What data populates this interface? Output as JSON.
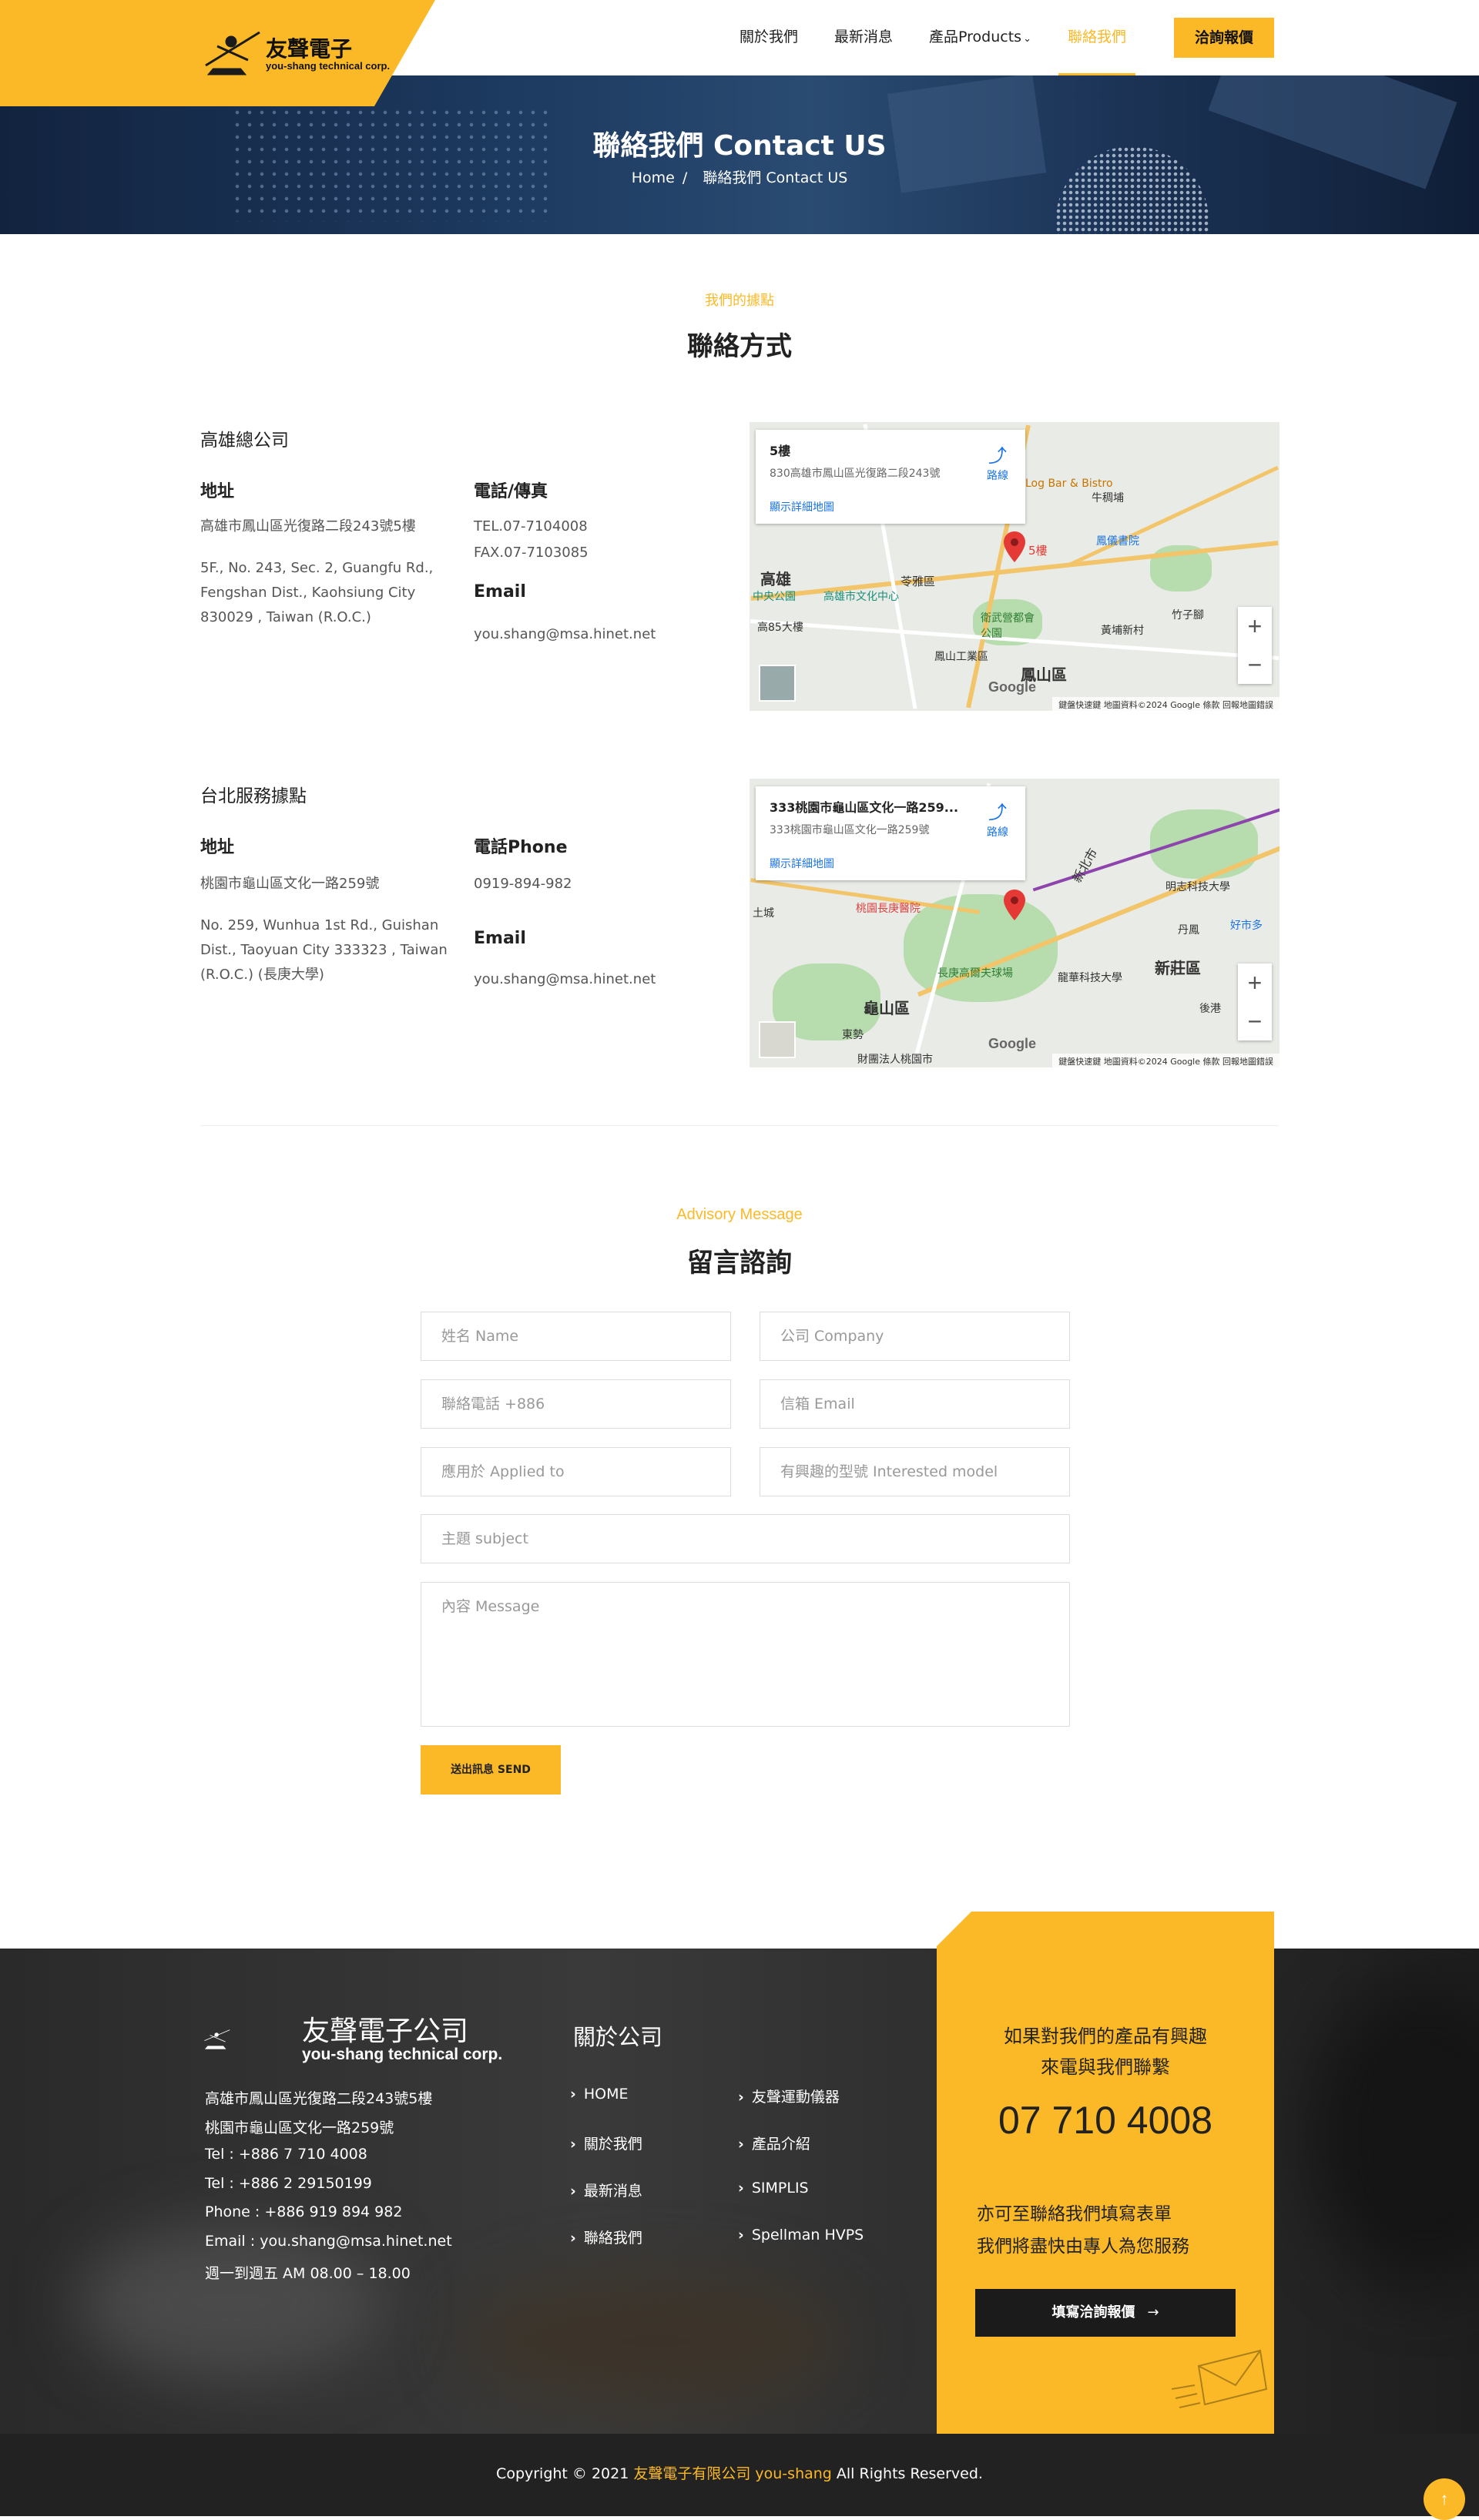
{
  "header": {
    "logo_cn": "友聲電子",
    "logo_en": "you-shang technical corp.",
    "nav": [
      "關於我們",
      "最新消息",
      "產品Products",
      "聯絡我們"
    ],
    "nav_dropdown_icon": "chevron-down-icon",
    "quote_label": "洽詢報價"
  },
  "banner": {
    "title": "聯絡我們 Contact US",
    "crumb_home": "Home",
    "crumb_sep": "/",
    "crumb_current": "聯絡我們 Contact US"
  },
  "contact": {
    "subtitle": "我們的據點",
    "title": "聯絡方式",
    "offices": [
      {
        "name": "高雄總公司",
        "addr_head": "地址",
        "addr_cn": "高雄市鳳山區光復路二段243號5樓",
        "addr_en": "5F., No. 243, Sec. 2, Guangfu Rd., Fengshan Dist., Kaohsiung City 830029 , Taiwan (R.O.C.)",
        "tel_head": "電話/傳真",
        "tel": "TEL.07-7104008",
        "fax": "FAX.07-7103085",
        "email_head": "Email",
        "email": "you.shang@msa.hinet.net",
        "map": {
          "card_title": "5樓",
          "card_addr": "830高雄市鳳山區光復路二段243號",
          "card_link": "顯示詳細地圖",
          "directions": "路線",
          "labels": [
            "高雄",
            "鳳山區",
            "高雄市文化中心",
            "衛武營都會公園",
            "鳳儀書院",
            "牛稠埔",
            "竹子腳",
            "黃埔新村",
            "鳳山工業區",
            "Log Bar & Bistro",
            "苓雅區",
            "高85大樓",
            "中央公園",
            "5樓"
          ],
          "attribution": "鍵盤快速鍵  地圖資料©2024 Google  條款  回報地圖錯誤"
        }
      },
      {
        "name": "台北服務據點",
        "addr_head": "地址",
        "addr_cn": "桃園市龜山區文化一路259號",
        "addr_en": "No. 259, Wunhua 1st Rd., Guishan Dist., Taoyuan City 333323 , Taiwan (R.O.C.) (長庚大學)",
        "tel_head": "電話Phone",
        "tel": "0919-894-982",
        "email_head": "Email",
        "email": "you.shang@msa.hinet.net",
        "map": {
          "card_title": "333桃園市龜山區文化一路259...",
          "card_addr": "333桃園市龜山區文化一路259號",
          "card_link": "顯示詳細地圖",
          "directions": "路線",
          "labels": [
            "龜山區",
            "新莊區",
            "桃園長庚醫院",
            "長庚高爾夫球場",
            "龍華科技大學",
            "明志科技大學",
            "新北市",
            "東勢",
            "丹鳳",
            "後港",
            "土城",
            "財團法人桃園市",
            "好市多"
          ],
          "attribution": "鍵盤快速鍵  地圖資料©2024 Google  條款  回報地圖錯誤"
        }
      }
    ]
  },
  "advisory": {
    "subtitle": "Advisory Message",
    "title": "留言諮詢",
    "placeholders": {
      "name": "姓名 Name",
      "company": "公司 Company",
      "phone": "聯絡電話 +886",
      "email": "信箱 Email",
      "applied": "應用於 Applied to",
      "model": "有興趣的型號 Interested model",
      "subject": "主題 subject",
      "message": "內容 Message"
    },
    "send_label": "送出訊息 SEND"
  },
  "footer": {
    "logo_cn": "友聲電子公司",
    "logo_en": "you-shang technical corp.",
    "info": [
      "高雄市鳳山區光復路二段243號5樓",
      "桃園市龜山區文化一路259號",
      "Tel : +886 7 710 4008",
      "Tel : +886 2 29150199",
      "Phone : +886 919 894 982",
      "Email : you.shang@msa.hinet.net",
      "週一到週五 AM 08.00 – 18.00"
    ],
    "links_head": "關於公司",
    "links_col1": [
      "HOME",
      "關於我們",
      "最新消息",
      "聯絡我們"
    ],
    "links_col2": [
      "友聲運動儀器",
      "產品介紹",
      "SIMPLIS",
      "Spellman HVPS"
    ],
    "cta": {
      "line1": "如果對我們的產品有興趣",
      "line2": "來電與我們聯繫",
      "phone": "07 710 4008",
      "line3": "亦可至聯絡我們填寫表單",
      "line4": "我們將盡快由專人為您服務",
      "button": "填寫洽詢報價",
      "button_icon": "arrow-right-icon",
      "decor_icon": "envelope-icon"
    }
  },
  "copyright": {
    "prefix": "Copyright © 2021 ",
    "company": "友聲電子有限公司 you-shang",
    "suffix": " All Rights Reserved."
  },
  "back_to_top_icon": "arrow-up-icon",
  "colors": {
    "accent": "#fbb927",
    "dark": "#222222"
  }
}
